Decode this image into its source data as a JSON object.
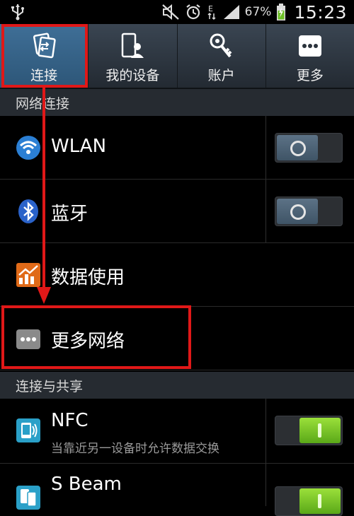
{
  "status_bar": {
    "battery_percent": "67%",
    "time": "15:23",
    "icons": [
      "usb-icon",
      "mute-icon",
      "alarm-icon",
      "data-e-icon",
      "signal-icon",
      "battery-charging-icon"
    ]
  },
  "tabs": [
    {
      "label": "连接",
      "icon": "connections-icon",
      "active": true
    },
    {
      "label": "我的设备",
      "icon": "my-device-icon",
      "active": false
    },
    {
      "label": "账户",
      "icon": "account-key-icon",
      "active": false
    },
    {
      "label": "更多",
      "icon": "more-icon",
      "active": false
    }
  ],
  "sections": {
    "network": {
      "header": "网络连接"
    },
    "share": {
      "header": "连接与共享"
    }
  },
  "rows": {
    "wlan": {
      "title": "WLAN",
      "toggle": "off"
    },
    "bluetooth": {
      "title": "蓝牙",
      "toggle": "off"
    },
    "data_usage": {
      "title": "数据使用"
    },
    "more_networks": {
      "title": "更多网络"
    },
    "nfc": {
      "title": "NFC",
      "subtitle": "当靠近另一设备时允许数据交换",
      "toggle": "on"
    },
    "sbeam": {
      "title": "S Beam",
      "toggle": "on"
    }
  },
  "colors": {
    "accent_active_tab": "#3f6f97",
    "highlight_red": "#e01818",
    "toggle_on": "#7cc82a"
  }
}
